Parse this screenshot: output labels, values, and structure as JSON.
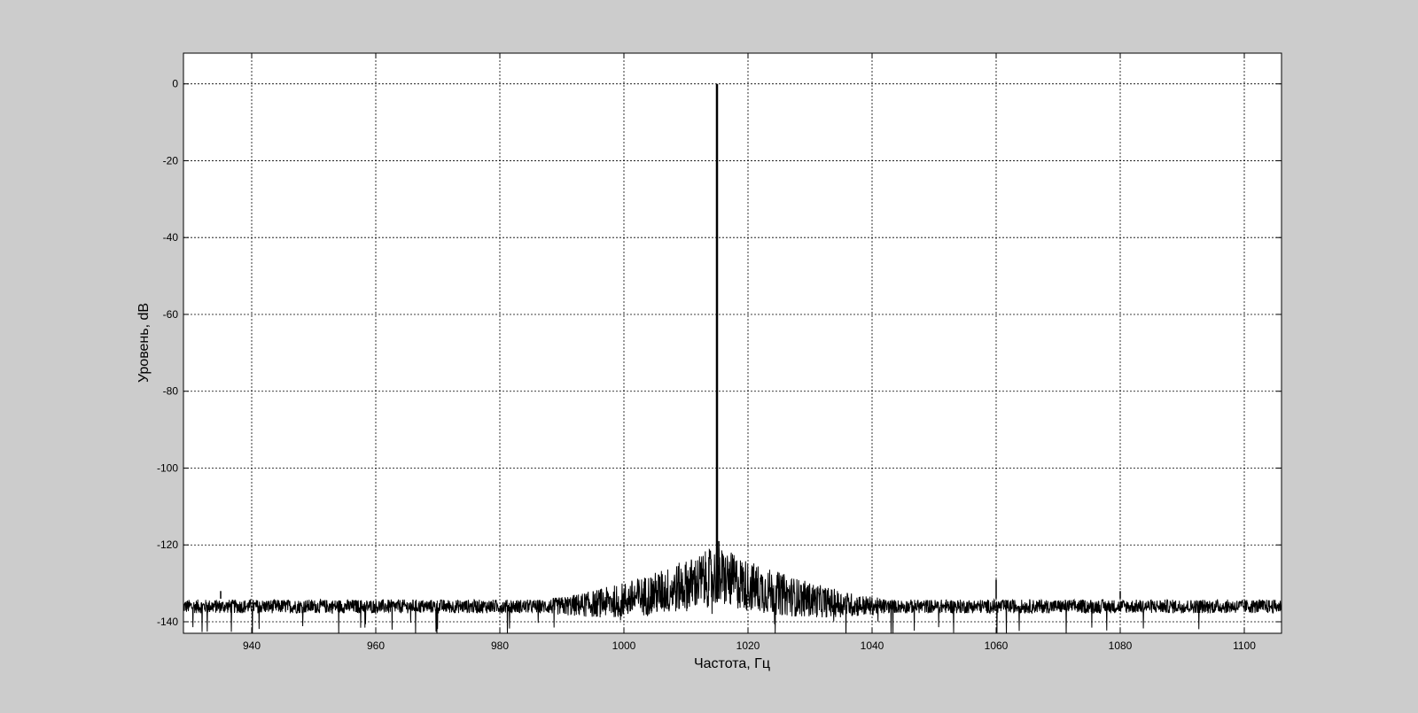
{
  "figure": {
    "background": "#cccccc",
    "plot_background": "#ffffff",
    "line_color": "#000000"
  },
  "chart_data": {
    "type": "line",
    "title": "",
    "xlabel": "Частота, Гц",
    "ylabel": "Уровень, dB",
    "xlim": [
      929,
      1106
    ],
    "ylim": [
      -143,
      8
    ],
    "grid": true,
    "grid_style": "dotted",
    "legend": "none",
    "xticks": [
      940,
      960,
      980,
      1000,
      1020,
      1040,
      1060,
      1080,
      1100
    ],
    "yticks": [
      0,
      -20,
      -40,
      -60,
      -80,
      -100,
      -120,
      -140
    ],
    "series": [
      {
        "noise_floor_db": -136,
        "noise_floor_at_center_db": -128,
        "noise_rise_center_hz": 1015,
        "noise_rise_halfwidth_hz": 28,
        "peaks": [
          {
            "x": 1015,
            "y": 0
          },
          {
            "x": 1015.3,
            "y": -119
          },
          {
            "x": 1060,
            "y": -129
          },
          {
            "x": 935,
            "y": -132
          },
          {
            "x": 1080,
            "y": -132
          }
        ]
      }
    ]
  }
}
